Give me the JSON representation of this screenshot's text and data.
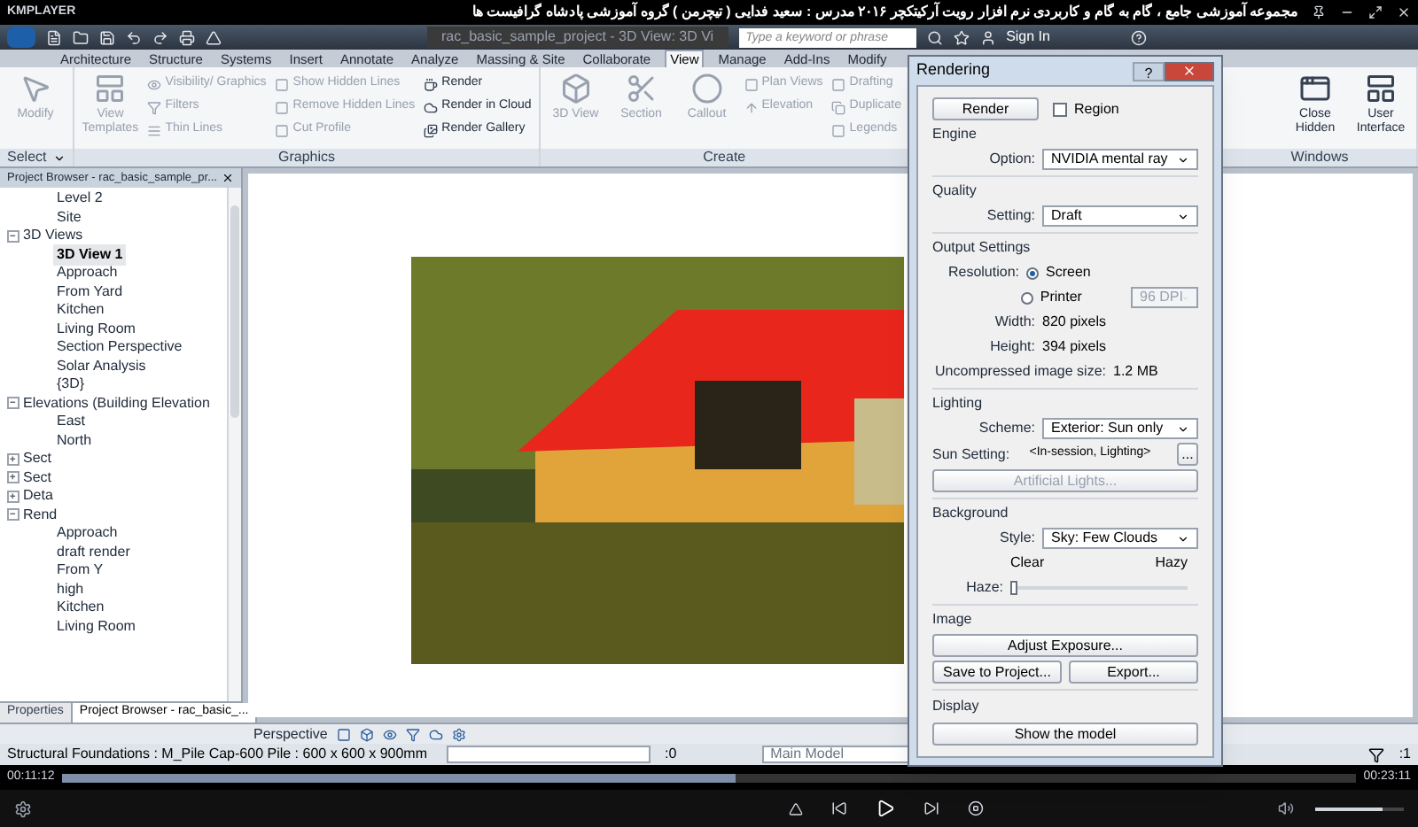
{
  "player": {
    "brand": "KMPLAYER",
    "title": "مجموعه آموزشی جامع ، گام به گام و کاربردی نرم افزار رویت آرکیتکچر ۲۰۱۶   مدرس : سعید فدایی ( تیچرمن ) گروه آموزشی پادشاه گرافیست ها",
    "elapsed": "00:11:12",
    "total": "00:23:11",
    "seek": {
      "level": 0.52
    },
    "volume": {
      "level": 0.75
    }
  },
  "revit": {
    "doc_title": "rac_basic_sample_project - 3D View: 3D Vi",
    "search": {
      "placeholder": "Type a keyword or phrase"
    },
    "sign_in": "Sign In",
    "tabs": [
      {
        "label": "Architecture",
        "selected": false
      },
      {
        "label": "Structure",
        "selected": false
      },
      {
        "label": "Systems",
        "selected": false
      },
      {
        "label": "Insert",
        "selected": false
      },
      {
        "label": "Annotate",
        "selected": false
      },
      {
        "label": "Analyze",
        "selected": false
      },
      {
        "label": "Massing & Site",
        "selected": false
      },
      {
        "label": "Collaborate",
        "selected": false
      },
      {
        "label": "View",
        "selected": true
      },
      {
        "label": "Manage",
        "selected": false
      },
      {
        "label": "Add-Ins",
        "selected": false
      },
      {
        "label": "Modify",
        "selected": false
      }
    ],
    "panels": [
      {
        "label": "Select",
        "dropdown": true,
        "columns": [
          [
            {
              "label": "Modify",
              "kind": "large",
              "disabled": true
            }
          ]
        ]
      },
      {
        "label": "Graphics",
        "columns": [
          [
            {
              "label": "View Templates",
              "kind": "large",
              "disabled": true
            }
          ],
          [
            {
              "label": "Visibility/ Graphics",
              "kind": "small",
              "disabled": true
            },
            {
              "label": "Filters",
              "kind": "small",
              "disabled": true
            },
            {
              "label": "Thin Lines",
              "kind": "small",
              "disabled": true
            }
          ],
          [
            {
              "label": "Show Hidden Lines",
              "kind": "small",
              "disabled": true
            },
            {
              "label": "Remove Hidden Lines",
              "kind": "small",
              "disabled": true
            },
            {
              "label": "Cut Profile",
              "kind": "small",
              "disabled": true
            }
          ],
          [
            {
              "label": "Render",
              "kind": "small",
              "disabled": false
            },
            {
              "label": "Render in Cloud",
              "kind": "small",
              "disabled": false
            },
            {
              "label": "Render Gallery",
              "kind": "small",
              "disabled": false
            }
          ]
        ]
      },
      {
        "label": "Create",
        "columns": [
          [
            {
              "label": "3D View",
              "kind": "large",
              "disabled": true
            }
          ],
          [
            {
              "label": "Section",
              "kind": "large",
              "disabled": true
            }
          ],
          [
            {
              "label": "Callout",
              "kind": "large",
              "disabled": true
            }
          ],
          [
            {
              "label": "Plan Views",
              "kind": "small",
              "disabled": true
            },
            {
              "label": "Elevation",
              "kind": "small",
              "disabled": true
            }
          ],
          [
            {
              "label": "Drafting",
              "kind": "small",
              "disabled": true
            },
            {
              "label": "Duplicate",
              "kind": "small",
              "disabled": true
            },
            {
              "label": "Legends",
              "kind": "small",
              "disabled": true
            }
          ]
        ]
      },
      {
        "label": "Windows",
        "columns": [
          [
            {
              "label": "Close Hidden",
              "kind": "large",
              "disabled": false
            }
          ],
          [
            {
              "label": "User Interface",
              "kind": "large",
              "disabled": false
            }
          ]
        ]
      }
    ],
    "browser": {
      "title": "Project Browser - rac_basic_sample_pr...",
      "tree": [
        {
          "kind": "continued",
          "children": [
            {
              "label": "Level 2",
              "selected": false
            },
            {
              "label": "Site",
              "selected": false
            }
          ]
        },
        {
          "kind": "group",
          "label": "3D Views",
          "expanded": true,
          "children": [
            {
              "label": "3D View 1",
              "selected": true
            },
            {
              "label": "Approach",
              "selected": false
            },
            {
              "label": "From Yard",
              "selected": false
            },
            {
              "label": "Kitchen",
              "selected": false
            },
            {
              "label": "Living Room",
              "selected": false
            },
            {
              "label": "Section Perspective",
              "selected": false
            },
            {
              "label": "Solar Analysis",
              "selected": false
            },
            {
              "label": "{3D}",
              "selected": false
            }
          ]
        },
        {
          "kind": "group",
          "label": "Elevations (Building Elevation",
          "expanded": true,
          "children": [
            {
              "label": "East",
              "selected": false
            },
            {
              "label": "North",
              "selected": false
            }
          ]
        },
        {
          "kind": "group",
          "label": "Sect",
          "expanded": false
        },
        {
          "kind": "group",
          "label": "Sect",
          "expanded": false
        },
        {
          "kind": "group",
          "label": "Deta",
          "expanded": false
        },
        {
          "kind": "group",
          "label": "Rend",
          "expanded": true,
          "children": [
            {
              "label": "Approach",
              "selected": false
            },
            {
              "label": "draft render",
              "selected": false
            },
            {
              "label": "From Y",
              "selected": false
            },
            {
              "label": "high",
              "selected": false
            },
            {
              "label": "Kitchen",
              "selected": false
            },
            {
              "label": "Living Room",
              "selected": false
            }
          ]
        }
      ],
      "tabs": [
        {
          "label": "Properties",
          "selected": false
        },
        {
          "label": "Project Browser - rac_basic_...",
          "selected": true
        }
      ]
    },
    "view_bar": {
      "label": "Perspective"
    },
    "status": {
      "text": "Structural Foundations : M_Pile Cap-600 Pile : 600 x 600 x 900mm",
      "editable_count": ":0",
      "model": "Main Model",
      "filter_count": ":1"
    }
  },
  "dialog": {
    "title": "Rendering",
    "help": "?",
    "render": "Render",
    "region": {
      "label": "Region",
      "checked": false
    },
    "engine": {
      "heading": "Engine",
      "label": "Option:",
      "value": "NVIDIA mental ray"
    },
    "quality": {
      "heading": "Quality",
      "label": "Setting:",
      "value": "Draft"
    },
    "output": {
      "heading": "Output Settings",
      "label": "Resolution:",
      "options": [
        {
          "label": "Screen",
          "selected": true
        },
        {
          "label": "Printer",
          "selected": false
        }
      ],
      "dpi": {
        "value": "96 DPI",
        "disabled": true
      },
      "width_label": "Width:",
      "width": "820 pixels",
      "height_label": "Height:",
      "height": "394 pixels",
      "size_label": "Uncompressed image size:",
      "size": "1.2 MB"
    },
    "lighting": {
      "heading": "Lighting",
      "scheme_label": "Scheme:",
      "scheme": "Exterior: Sun only",
      "sun_label": "Sun Setting:",
      "sun": "<In-session, Lighting>",
      "more": "...",
      "artificial": {
        "label": "Artificial Lights...",
        "disabled": true
      }
    },
    "background": {
      "heading": "Background",
      "style_label": "Style:",
      "style": "Sky: Few Clouds",
      "clear": "Clear",
      "hazy": "Hazy",
      "haze_label": "Haze:",
      "haze": {
        "level": 0
      }
    },
    "image": {
      "heading": "Image",
      "adjust": "Adjust Exposure...",
      "save": "Save to Project...",
      "export": "Export..."
    },
    "display": {
      "heading": "Display",
      "show": "Show the model"
    }
  }
}
